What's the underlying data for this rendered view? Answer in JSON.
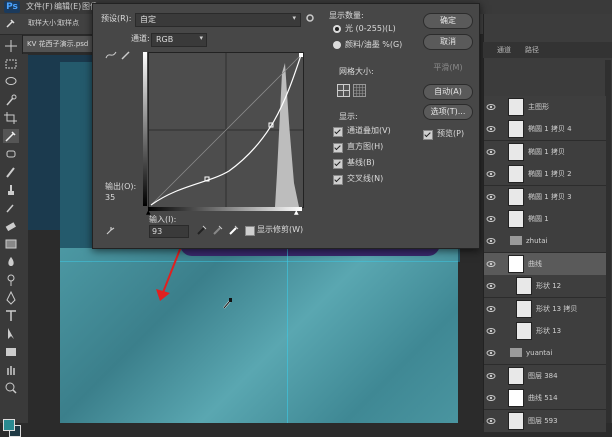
{
  "app": {
    "logo": "Ps",
    "menu": [
      "文件(F)",
      "编辑(E)",
      "图像(I)"
    ]
  },
  "options": {
    "sample_size_label": "取样大小：",
    "sample_size_value": "取样点"
  },
  "document": {
    "tab_title": "KV 花西子演示.psd"
  },
  "curves": {
    "preset_label": "预设(R):",
    "preset_value": "自定",
    "channel_label": "通道:",
    "channel_value": "RGB",
    "ok": "确定",
    "cancel": "取消",
    "smooth": "平滑(M)",
    "auto": "自动(A)",
    "options": "选项(T)...",
    "preview": "预览(P)",
    "show_amount_title": "显示数量:",
    "light": "光 (0-255)(L)",
    "pigment": "颜料/油墨 %(G)",
    "grid_size_title": "网格大小:",
    "display_title": "显示:",
    "checkboxes": [
      "通道叠加(V)",
      "直方图(H)",
      "基线(B)",
      "交叉线(N)"
    ],
    "output_label": "输出(O):",
    "output_value": "35",
    "input_label": "输入(I):",
    "input_value": "93",
    "show_clipping": "显示修剪(W)"
  },
  "layers_panel": {
    "tabs": [
      "通道",
      "路径"
    ],
    "layers": [
      {
        "name": "主图形",
        "kind": "group"
      },
      {
        "name": "椭圆 1 拷贝 4",
        "kind": "shape"
      },
      {
        "name": "椭圆 1 拷贝",
        "kind": "shape"
      },
      {
        "name": "椭圆 1 拷贝 2",
        "kind": "shape"
      },
      {
        "name": "椭圆 1 拷贝 3",
        "kind": "shape"
      },
      {
        "name": "椭圆 1",
        "kind": "shape"
      },
      {
        "name": "zhutai",
        "kind": "folder"
      },
      {
        "name": "曲线",
        "kind": "adjust"
      },
      {
        "name": "形状 12",
        "kind": "shape"
      },
      {
        "name": "形状 13 拷贝",
        "kind": "shape"
      },
      {
        "name": "形状 13",
        "kind": "shape"
      },
      {
        "name": "yuantai",
        "kind": "folder"
      },
      {
        "name": "图层 384",
        "kind": "pixel"
      },
      {
        "name": "曲线 514",
        "kind": "adjust"
      },
      {
        "name": "图层 593",
        "kind": "pixel"
      }
    ]
  }
}
